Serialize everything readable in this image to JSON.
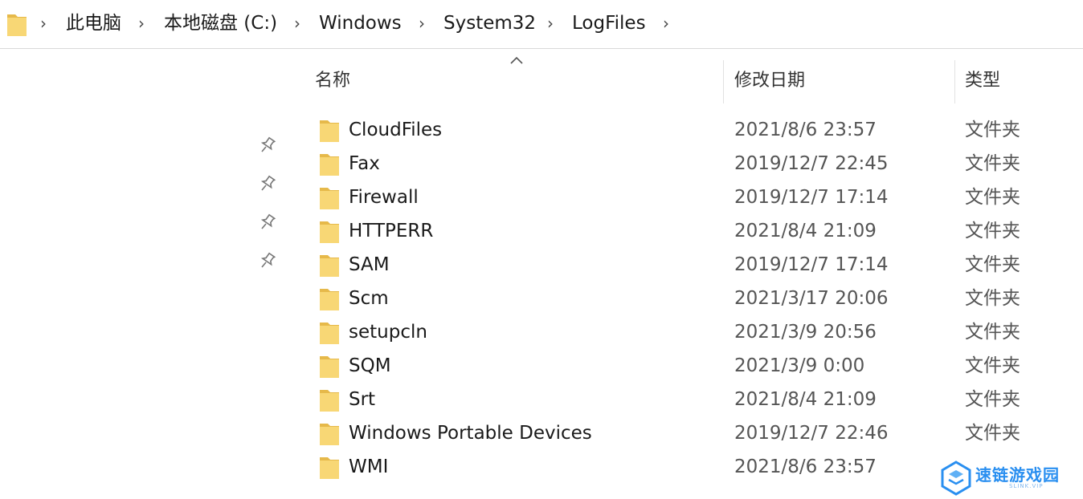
{
  "breadcrumb": {
    "items": [
      "此电脑",
      "本地磁盘 (C:)",
      "Windows",
      "System32",
      "LogFiles"
    ]
  },
  "columns": {
    "name": "名称",
    "date_modified": "修改日期",
    "type": "类型",
    "sorted_column": "名称",
    "sort_direction": "ascending"
  },
  "files": [
    {
      "name": "CloudFiles",
      "date": "2021/8/6 23:57",
      "type": "文件夹"
    },
    {
      "name": "Fax",
      "date": "2019/12/7 22:45",
      "type": "文件夹"
    },
    {
      "name": "Firewall",
      "date": "2019/12/7 17:14",
      "type": "文件夹"
    },
    {
      "name": "HTTPERR",
      "date": "2021/8/4 21:09",
      "type": "文件夹"
    },
    {
      "name": "SAM",
      "date": "2019/12/7 17:14",
      "type": "文件夹"
    },
    {
      "name": "Scm",
      "date": "2021/3/17 20:06",
      "type": "文件夹"
    },
    {
      "name": "setupcln",
      "date": "2021/3/9 20:56",
      "type": "文件夹"
    },
    {
      "name": "SQM",
      "date": "2021/3/9 0:00",
      "type": "文件夹"
    },
    {
      "name": "Srt",
      "date": "2021/8/4 21:09",
      "type": "文件夹"
    },
    {
      "name": "Windows Portable Devices",
      "date": "2019/12/7 22:46",
      "type": "文件夹"
    },
    {
      "name": "WMI",
      "date": "2021/8/6 23:57",
      "type": ""
    }
  ],
  "icons": {
    "folder": "folder-icon",
    "pin": "pin-icon",
    "chevron": "chevron-right-icon",
    "sort": "sort-up-icon"
  },
  "watermark": {
    "text": "速链游戏园",
    "subtext": "SLINK.VIP"
  },
  "colors": {
    "folder": "#f8d775",
    "folder_dark": "#e6b94a",
    "watermark": "#2a8ff0"
  }
}
